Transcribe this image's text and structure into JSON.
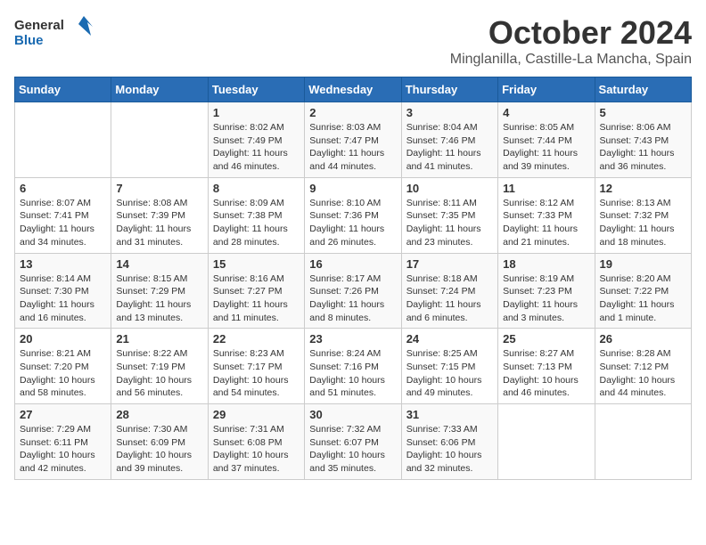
{
  "header": {
    "logo_general": "General",
    "logo_blue": "Blue",
    "month": "October 2024",
    "location": "Minglanilla, Castille-La Mancha, Spain"
  },
  "days_of_week": [
    "Sunday",
    "Monday",
    "Tuesday",
    "Wednesday",
    "Thursday",
    "Friday",
    "Saturday"
  ],
  "weeks": [
    [
      {
        "day": "",
        "sunrise": "",
        "sunset": "",
        "daylight": ""
      },
      {
        "day": "",
        "sunrise": "",
        "sunset": "",
        "daylight": ""
      },
      {
        "day": "1",
        "sunrise": "Sunrise: 8:02 AM",
        "sunset": "Sunset: 7:49 PM",
        "daylight": "Daylight: 11 hours and 46 minutes."
      },
      {
        "day": "2",
        "sunrise": "Sunrise: 8:03 AM",
        "sunset": "Sunset: 7:47 PM",
        "daylight": "Daylight: 11 hours and 44 minutes."
      },
      {
        "day": "3",
        "sunrise": "Sunrise: 8:04 AM",
        "sunset": "Sunset: 7:46 PM",
        "daylight": "Daylight: 11 hours and 41 minutes."
      },
      {
        "day": "4",
        "sunrise": "Sunrise: 8:05 AM",
        "sunset": "Sunset: 7:44 PM",
        "daylight": "Daylight: 11 hours and 39 minutes."
      },
      {
        "day": "5",
        "sunrise": "Sunrise: 8:06 AM",
        "sunset": "Sunset: 7:43 PM",
        "daylight": "Daylight: 11 hours and 36 minutes."
      }
    ],
    [
      {
        "day": "6",
        "sunrise": "Sunrise: 8:07 AM",
        "sunset": "Sunset: 7:41 PM",
        "daylight": "Daylight: 11 hours and 34 minutes."
      },
      {
        "day": "7",
        "sunrise": "Sunrise: 8:08 AM",
        "sunset": "Sunset: 7:39 PM",
        "daylight": "Daylight: 11 hours and 31 minutes."
      },
      {
        "day": "8",
        "sunrise": "Sunrise: 8:09 AM",
        "sunset": "Sunset: 7:38 PM",
        "daylight": "Daylight: 11 hours and 28 minutes."
      },
      {
        "day": "9",
        "sunrise": "Sunrise: 8:10 AM",
        "sunset": "Sunset: 7:36 PM",
        "daylight": "Daylight: 11 hours and 26 minutes."
      },
      {
        "day": "10",
        "sunrise": "Sunrise: 8:11 AM",
        "sunset": "Sunset: 7:35 PM",
        "daylight": "Daylight: 11 hours and 23 minutes."
      },
      {
        "day": "11",
        "sunrise": "Sunrise: 8:12 AM",
        "sunset": "Sunset: 7:33 PM",
        "daylight": "Daylight: 11 hours and 21 minutes."
      },
      {
        "day": "12",
        "sunrise": "Sunrise: 8:13 AM",
        "sunset": "Sunset: 7:32 PM",
        "daylight": "Daylight: 11 hours and 18 minutes."
      }
    ],
    [
      {
        "day": "13",
        "sunrise": "Sunrise: 8:14 AM",
        "sunset": "Sunset: 7:30 PM",
        "daylight": "Daylight: 11 hours and 16 minutes."
      },
      {
        "day": "14",
        "sunrise": "Sunrise: 8:15 AM",
        "sunset": "Sunset: 7:29 PM",
        "daylight": "Daylight: 11 hours and 13 minutes."
      },
      {
        "day": "15",
        "sunrise": "Sunrise: 8:16 AM",
        "sunset": "Sunset: 7:27 PM",
        "daylight": "Daylight: 11 hours and 11 minutes."
      },
      {
        "day": "16",
        "sunrise": "Sunrise: 8:17 AM",
        "sunset": "Sunset: 7:26 PM",
        "daylight": "Daylight: 11 hours and 8 minutes."
      },
      {
        "day": "17",
        "sunrise": "Sunrise: 8:18 AM",
        "sunset": "Sunset: 7:24 PM",
        "daylight": "Daylight: 11 hours and 6 minutes."
      },
      {
        "day": "18",
        "sunrise": "Sunrise: 8:19 AM",
        "sunset": "Sunset: 7:23 PM",
        "daylight": "Daylight: 11 hours and 3 minutes."
      },
      {
        "day": "19",
        "sunrise": "Sunrise: 8:20 AM",
        "sunset": "Sunset: 7:22 PM",
        "daylight": "Daylight: 11 hours and 1 minute."
      }
    ],
    [
      {
        "day": "20",
        "sunrise": "Sunrise: 8:21 AM",
        "sunset": "Sunset: 7:20 PM",
        "daylight": "Daylight: 10 hours and 58 minutes."
      },
      {
        "day": "21",
        "sunrise": "Sunrise: 8:22 AM",
        "sunset": "Sunset: 7:19 PM",
        "daylight": "Daylight: 10 hours and 56 minutes."
      },
      {
        "day": "22",
        "sunrise": "Sunrise: 8:23 AM",
        "sunset": "Sunset: 7:17 PM",
        "daylight": "Daylight: 10 hours and 54 minutes."
      },
      {
        "day": "23",
        "sunrise": "Sunrise: 8:24 AM",
        "sunset": "Sunset: 7:16 PM",
        "daylight": "Daylight: 10 hours and 51 minutes."
      },
      {
        "day": "24",
        "sunrise": "Sunrise: 8:25 AM",
        "sunset": "Sunset: 7:15 PM",
        "daylight": "Daylight: 10 hours and 49 minutes."
      },
      {
        "day": "25",
        "sunrise": "Sunrise: 8:27 AM",
        "sunset": "Sunset: 7:13 PM",
        "daylight": "Daylight: 10 hours and 46 minutes."
      },
      {
        "day": "26",
        "sunrise": "Sunrise: 8:28 AM",
        "sunset": "Sunset: 7:12 PM",
        "daylight": "Daylight: 10 hours and 44 minutes."
      }
    ],
    [
      {
        "day": "27",
        "sunrise": "Sunrise: 7:29 AM",
        "sunset": "Sunset: 6:11 PM",
        "daylight": "Daylight: 10 hours and 42 minutes."
      },
      {
        "day": "28",
        "sunrise": "Sunrise: 7:30 AM",
        "sunset": "Sunset: 6:09 PM",
        "daylight": "Daylight: 10 hours and 39 minutes."
      },
      {
        "day": "29",
        "sunrise": "Sunrise: 7:31 AM",
        "sunset": "Sunset: 6:08 PM",
        "daylight": "Daylight: 10 hours and 37 minutes."
      },
      {
        "day": "30",
        "sunrise": "Sunrise: 7:32 AM",
        "sunset": "Sunset: 6:07 PM",
        "daylight": "Daylight: 10 hours and 35 minutes."
      },
      {
        "day": "31",
        "sunrise": "Sunrise: 7:33 AM",
        "sunset": "Sunset: 6:06 PM",
        "daylight": "Daylight: 10 hours and 32 minutes."
      },
      {
        "day": "",
        "sunrise": "",
        "sunset": "",
        "daylight": ""
      },
      {
        "day": "",
        "sunrise": "",
        "sunset": "",
        "daylight": ""
      }
    ]
  ]
}
